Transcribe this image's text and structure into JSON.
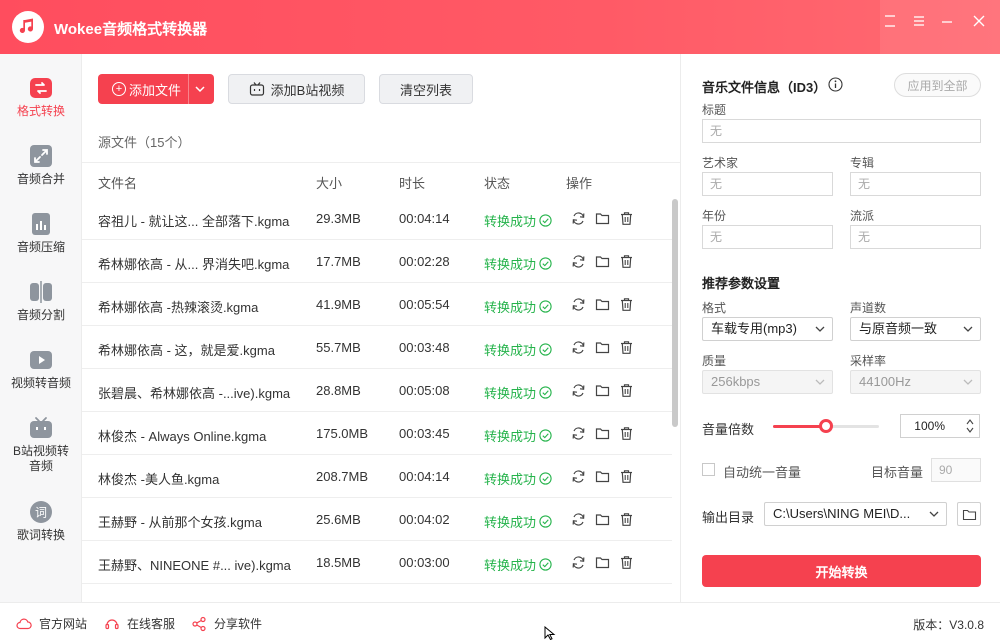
{
  "app": {
    "title": "Wokee音频格式转换器"
  },
  "colors": {
    "brand": "#f5414f",
    "success": "#25b34b"
  },
  "sidebar": {
    "items": [
      {
        "label": "格式转换",
        "icon": "format-convert-icon",
        "active": true
      },
      {
        "label": "音频合并",
        "icon": "audio-merge-icon",
        "active": false
      },
      {
        "label": "音频压缩",
        "icon": "audio-compress-icon",
        "active": false
      },
      {
        "label": "音频分割",
        "icon": "audio-split-icon",
        "active": false
      },
      {
        "label": "视频转音频",
        "icon": "video-to-audio-icon",
        "active": false
      },
      {
        "label": "B站视频转音频",
        "icon": "bilibili-icon",
        "active": false
      },
      {
        "label": "歌词转换",
        "icon": "lyrics-icon",
        "active": false
      }
    ]
  },
  "toolbar": {
    "add_file": "添加文件",
    "add_bilibili": "添加B站视频",
    "clear_list": "清空列表"
  },
  "source_label": "源文件（15个）",
  "table": {
    "headers": {
      "name": "文件名",
      "size": "大小",
      "duration": "时长",
      "status": "状态",
      "actions": "操作"
    },
    "rows": [
      {
        "name": "容祖儿 - 就让这... 全部落下.kgma",
        "size": "29.3MB",
        "duration": "00:04:14",
        "status": "转换成功"
      },
      {
        "name": "希林娜依高 - 从... 界消失吧.kgma",
        "size": "17.7MB",
        "duration": "00:02:28",
        "status": "转换成功"
      },
      {
        "name": "希林娜依高 -热辣滚烫.kgma",
        "size": "41.9MB",
        "duration": "00:05:54",
        "status": "转换成功"
      },
      {
        "name": "希林娜依高 - 这，就是爱.kgma",
        "size": "55.7MB",
        "duration": "00:03:48",
        "status": "转换成功"
      },
      {
        "name": "张碧晨、希林娜依高 -...ive).kgma",
        "size": "28.8MB",
        "duration": "00:05:08",
        "status": "转换成功"
      },
      {
        "name": "林俊杰 - Always Online.kgma",
        "size": "175.0MB",
        "duration": "00:03:45",
        "status": "转换成功"
      },
      {
        "name": "林俊杰 -美人鱼.kgma",
        "size": "208.7MB",
        "duration": "00:04:14",
        "status": "转换成功"
      },
      {
        "name": "王赫野 - 从前那个女孩.kgma",
        "size": "25.6MB",
        "duration": "00:04:02",
        "status": "转换成功"
      },
      {
        "name": "王赫野、NINEONE #... ive).kgma",
        "size": "18.5MB",
        "duration": "00:03:00",
        "status": "转换成功"
      }
    ]
  },
  "id3": {
    "title": "音乐文件信息（ID3）",
    "apply_all": "应用到全部",
    "fields": {
      "title_label": "标题",
      "title_value": "无",
      "artist_label": "艺术家",
      "artist_value": "无",
      "album_label": "专辑",
      "album_value": "无",
      "year_label": "年份",
      "year_value": "无",
      "genre_label": "流派",
      "genre_value": "无"
    }
  },
  "params": {
    "title": "推荐参数设置",
    "format_label": "格式",
    "format_value": "车载专用(mp3)",
    "channels_label": "声道数",
    "channels_value": "与原音频一致",
    "quality_label": "质量",
    "quality_value": "256kbps",
    "samplerate_label": "采样率",
    "samplerate_value": "44100Hz",
    "volume_label": "音量倍数",
    "volume_value": "100%",
    "volume_level": 0.5,
    "auto_volume_label": "自动统一音量",
    "target_volume_label": "目标音量",
    "target_volume_value": "90",
    "output_label": "输出目录",
    "output_value": "C:\\Users\\NING MEI\\D...",
    "start_button": "开始转换"
  },
  "footer": {
    "website": "官方网站",
    "support": "在线客服",
    "share": "分享软件",
    "version": "版本：V3.0.8"
  }
}
